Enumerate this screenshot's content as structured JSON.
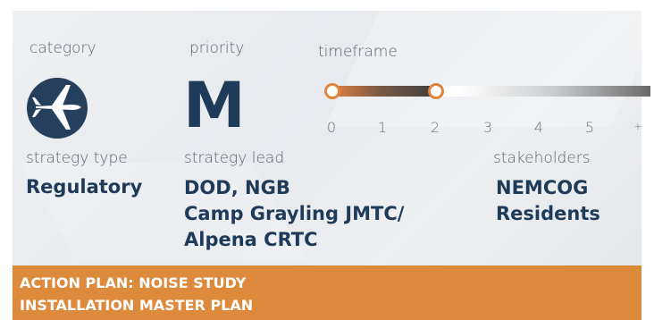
{
  "category": {
    "label": "category",
    "icon": "airplane-icon"
  },
  "priority": {
    "label": "priority",
    "value": "M"
  },
  "timeframe": {
    "label": "timeframe",
    "range": [
      0,
      2
    ],
    "ticks": [
      "0",
      "1",
      "2",
      "3",
      "4",
      "5",
      "+"
    ]
  },
  "strategy_type": {
    "label": "strategy type",
    "value": "Regulatory"
  },
  "strategy_lead": {
    "label": "strategy lead",
    "lines": [
      "DOD, NGB",
      "Camp Grayling JMTC/",
      "Alpena CRTC"
    ]
  },
  "stakeholders": {
    "label": "stakeholders",
    "lines": [
      "NEMCOG",
      "Residents"
    ]
  },
  "action_plan": {
    "lines": [
      "ACTION PLAN: NOISE STUDY",
      "INSTALLATION MASTER PLAN"
    ]
  },
  "colors": {
    "navy": "#1f3b5a",
    "orange": "#de8a3d"
  }
}
